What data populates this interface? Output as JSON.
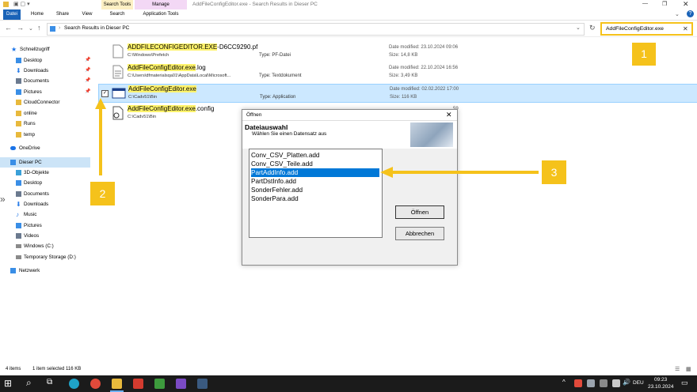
{
  "window": {
    "title": "AddFileConfigEditor.exe - Search Results in Dieser PC",
    "context_search_tools": "Search Tools",
    "context_manage": "Manage"
  },
  "ribbon": {
    "tabs": [
      "Datei",
      "Home",
      "Share",
      "View",
      "Search",
      "Application Tools"
    ]
  },
  "address": {
    "path": "Search Results in Dieser PC",
    "search_value": "AddFileConfigEditor.exe"
  },
  "sidebar": {
    "items": [
      {
        "label": "Schnellzugriff",
        "icon": "star-icon",
        "color": "#1a73e8"
      },
      {
        "label": "Desktop",
        "icon": "desktop-icon",
        "color": "#3a8ee6",
        "pinned": true
      },
      {
        "label": "Downloads",
        "icon": "download-icon",
        "color": "#2b7de9",
        "pinned": true
      },
      {
        "label": "Documents",
        "icon": "document-icon",
        "color": "#6b7a8f",
        "pinned": true
      },
      {
        "label": "Pictures",
        "icon": "picture-icon",
        "color": "#3a8ee6",
        "pinned": true
      },
      {
        "label": "CloudConnector",
        "icon": "folder-icon",
        "color": "#e8b93c"
      },
      {
        "label": "online",
        "icon": "folder-icon",
        "color": "#e8b93c"
      },
      {
        "label": "Runs",
        "icon": "folder-icon",
        "color": "#e8b93c"
      },
      {
        "label": "temp",
        "icon": "folder-icon",
        "color": "#e8b93c"
      },
      {
        "label": "OneDrive",
        "icon": "cloud-icon",
        "color": "#1a73e8"
      },
      {
        "label": "Dieser PC",
        "icon": "computer-icon",
        "color": "#3a8ee6",
        "selected": true
      },
      {
        "label": "3D-Objekte",
        "icon": "cube-icon",
        "color": "#3aa0d8"
      },
      {
        "label": "Desktop",
        "icon": "desktop-icon",
        "color": "#3a8ee6"
      },
      {
        "label": "Documents",
        "icon": "document-icon",
        "color": "#6b7a8f"
      },
      {
        "label": "Downloads",
        "icon": "download-icon",
        "color": "#2b7de9"
      },
      {
        "label": "Music",
        "icon": "music-icon",
        "color": "#2b7de9"
      },
      {
        "label": "Pictures",
        "icon": "picture-icon",
        "color": "#3a8ee6"
      },
      {
        "label": "Videos",
        "icon": "video-icon",
        "color": "#6b7a8f"
      },
      {
        "label": "Windows (C:)",
        "icon": "drive-icon",
        "color": "#8a8a8a"
      },
      {
        "label": "Temporary Storage (D:)",
        "icon": "drive-icon",
        "color": "#8a8a8a"
      },
      {
        "label": "Netzwerk",
        "icon": "network-icon",
        "color": "#3a8ee6"
      }
    ]
  },
  "files": [
    {
      "name_hl": "ADDFILECONFIGEDITOR.EXE",
      "name_rest": "-D6CC9290.pf",
      "path": "C:\\Windows\\Prefetch",
      "type": "Type: PF-Datei",
      "date": "Date modified: 23.10.2024 09:06",
      "size": "Size: 14,8 KB",
      "icon": "file-icon"
    },
    {
      "name_hl": "AddFileConfigEditor.exe",
      "name_rest": ".log",
      "path": "C:\\Users\\dfmaterialsqa01\\AppData\\Local\\Microsoft...",
      "type": "Type: Textdokument",
      "date": "Date modified: 22.10.2024 16:56",
      "size": "Size: 3,49 KB",
      "icon": "text-file-icon"
    },
    {
      "name_hl": "AddFileConfigEditor.exe",
      "name_rest": "",
      "path": "C:\\Cadv51\\Bin",
      "type": "Type: Application",
      "date": "Date modified: 02.02.2022 17:00",
      "size": "Size: 116 KB",
      "icon": "application-icon",
      "selected": true
    },
    {
      "name_hl": "AddFileConfigEditor.exe",
      "name_rest": ".config",
      "path": "C:\\Cadv51\\Bin",
      "type": "",
      "date": "59",
      "size": "",
      "icon": "config-file-icon"
    }
  ],
  "dialog": {
    "title": "Öffnen",
    "heading": "Dateiauswahl",
    "subheading": "Wählen Sie einen Datensatz aus",
    "items": [
      "Conv_CSV_Platten.add",
      "Conv_CSV_Teile.add",
      "PartAddInfo.add",
      "PartDstInfo.add",
      "SonderFehler.add",
      "SonderPara.add"
    ],
    "selected_index": 2,
    "open_label": "Öffnen",
    "cancel_label": "Abbrechen"
  },
  "annotations": {
    "badge1": "1",
    "badge2": "2",
    "badge3": "3",
    "color": "#f5c21b"
  },
  "statusbar": {
    "items": "4 items",
    "selected": "1 item selected  116 KB"
  },
  "taskbar": {
    "lang": "DEU",
    "time": "09:23",
    "date": "23.10.2024"
  }
}
